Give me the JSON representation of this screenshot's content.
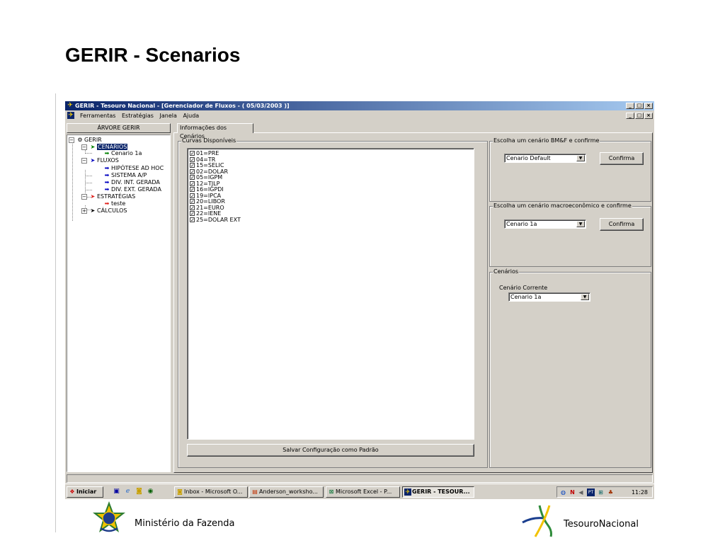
{
  "slide": {
    "title": "GERIR - Scenarios"
  },
  "window": {
    "title": "GERIR - Tesouro Nacional - [Gerenciador de Fluxos - ( 05/03/2003 )]",
    "window_buttons": [
      "_",
      "□",
      "×"
    ]
  },
  "menu": {
    "items": [
      "Ferramentas",
      "Estratégias",
      "Janela",
      "Ajuda"
    ]
  },
  "tree": {
    "header": "ÁRVORE GERIR",
    "nodes": {
      "root": "GERIR",
      "cenarios": "CENÁRIOS",
      "cenario_1a": "Cenario 1a",
      "fluxos": "FLUXOS",
      "hipotese": "HIPÓTESE AD HOC",
      "sistema": "SISTEMA A/P",
      "div_int": "DIV. INT. GERADA",
      "div_ext": "DIV. EXT. GERADA",
      "estrategias": "ESTRATÉGIAS",
      "teste": "teste",
      "calculos": "CÁLCULOS"
    }
  },
  "main": {
    "tab_label": "Informações dos Cenários",
    "curves_group_label": "Curvas Disponíveis",
    "curves": [
      {
        "label": "01=PRE",
        "checked": true
      },
      {
        "label": "04=TR",
        "checked": true
      },
      {
        "label": "15=SELIC",
        "checked": true
      },
      {
        "label": "02=DOLAR",
        "checked": true
      },
      {
        "label": "05=IGPM",
        "checked": true
      },
      {
        "label": "12=TJLP",
        "checked": true
      },
      {
        "label": "16=IGPDI",
        "checked": true
      },
      {
        "label": "19=IPCA",
        "checked": true
      },
      {
        "label": "20=LIBOR",
        "checked": true
      },
      {
        "label": "21=EURO",
        "checked": true
      },
      {
        "label": "22=IENE",
        "checked": true
      },
      {
        "label": "25=DOLAR EXT",
        "checked": true
      }
    ],
    "save_button": "Salvar Configuração como Padrão"
  },
  "bmf_group": {
    "label": "Escolha um cenário BM&F e confirme",
    "selected": "Cenario Default",
    "confirm": "Confirma"
  },
  "macro_group": {
    "label": "Escolha um cenário macroeconômico e confirme",
    "selected": "Cenario 1a",
    "confirm": "Confirma"
  },
  "cenarios_group": {
    "label": "Cenários",
    "current_label": "Cenário Corrente",
    "selected": "Cenario 1a"
  },
  "taskbar": {
    "start": "Iniciar",
    "tasks": [
      "Inbox - Microsoft O...",
      "Anderson_worksho...",
      "Microsoft Excel - P...",
      "GERIR - TESOUR..."
    ],
    "clock": "11:28"
  },
  "footer": {
    "left": "Ministério da Fazenda",
    "right": "TesouroNacional"
  },
  "colors": {
    "titlebar_start": "#0a246a",
    "titlebar_end": "#a6caf0",
    "window_face": "#d4d0c8",
    "selection": "#0a246a"
  }
}
